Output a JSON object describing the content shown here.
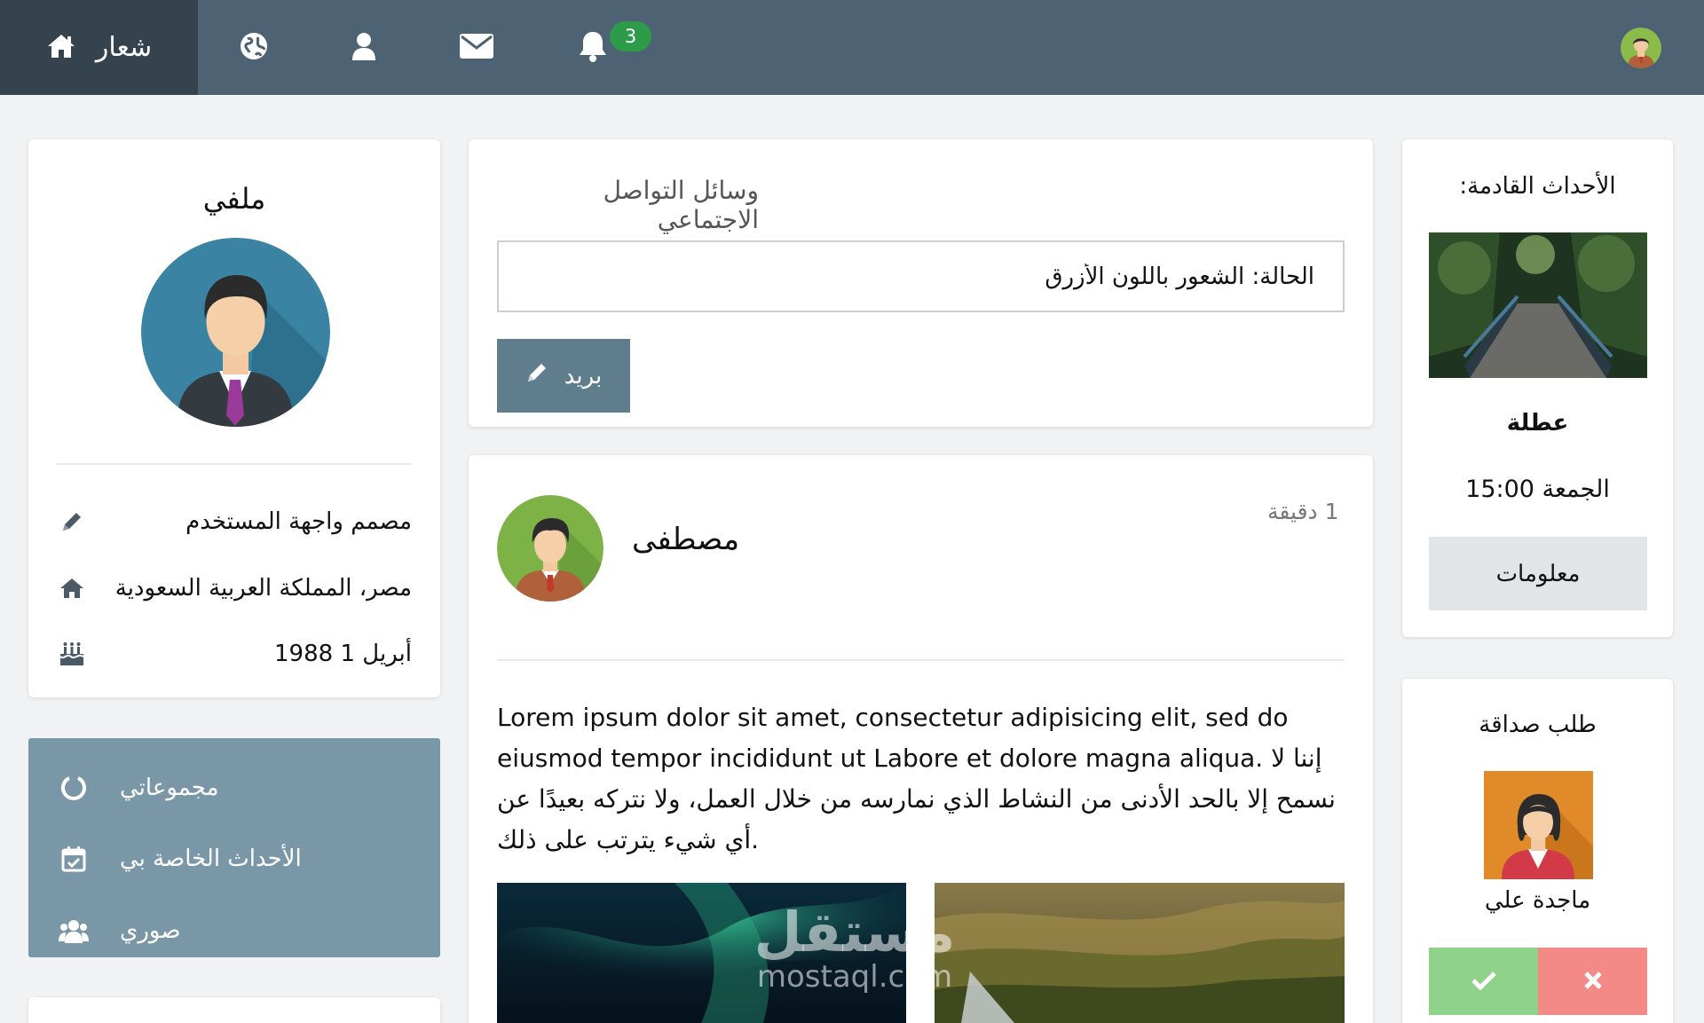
{
  "navbar": {
    "brand_label": "شعار",
    "notification_count": "3",
    "icons": [
      "home-icon",
      "globe-icon",
      "user-icon",
      "envelope-icon",
      "bell-icon"
    ]
  },
  "profile": {
    "title": "ملفي",
    "job": "مصمم واجهة المستخدم",
    "location": "مصر، المملكة العربية السعودية",
    "birthday": "أبريل 1 1988"
  },
  "side_menu": {
    "items": [
      {
        "label": "مجموعاتي",
        "icon": "circle-notch-icon"
      },
      {
        "label": "الأحداث الخاصة بي",
        "icon": "calendar-check-icon"
      },
      {
        "label": "صوري",
        "icon": "users-icon"
      }
    ]
  },
  "status": {
    "title": "وسائل التواصل الاجتماعي",
    "input_value": "الحالة: الشعور باللون الأزرق",
    "post_button_label": "بريد"
  },
  "post": {
    "time": "1 دقيقة",
    "author": "مصطفى",
    "body": "Lorem ipsum dolor sit amet, consectetur adipisicing elit, sed do eiusmod tempor incididunt ut Labore et dolore magna aliqua. إننا لا نسمح إلا بالحد الأدنى من النشاط الذي نمارسه من خلال العمل، ولا نتركه بعيدًا عن أي شيء يترتب على ذلك."
  },
  "events": {
    "title": ":الأحداث القادمة",
    "event_name": "عطلة",
    "event_time": "الجمعة 15:00",
    "info_button_label": "معلومات"
  },
  "friend_request": {
    "title": "طلب صداقة",
    "name": "ماجدة علي"
  },
  "watermark": {
    "arabic": "مستقل",
    "latin": "mostaql.com"
  },
  "colors": {
    "navbar": "#4d6272",
    "brand": "#34434d",
    "menu": "#7a97a8",
    "badge": "#2e9b4a",
    "accept": "#8fd38a",
    "reject": "#f48a87"
  }
}
